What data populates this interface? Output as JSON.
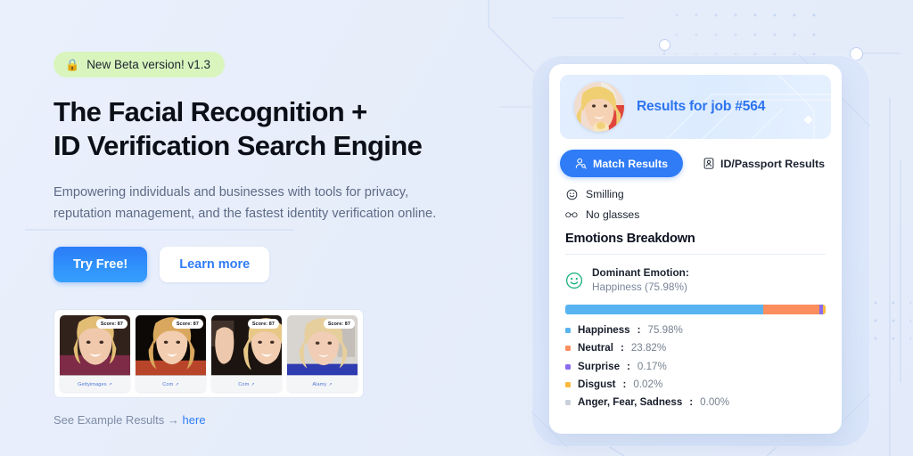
{
  "theme": {
    "page_bg": "#e8eefb",
    "accent_blue": "#2f7cf6",
    "badge_green": "#d9f5bd",
    "text_dark": "#0b0f17",
    "text_muted": "#5d6b86"
  },
  "hero": {
    "badge": {
      "icon": "lock-icon",
      "label": "New Beta version! v1.3"
    },
    "headline_line1": "The Facial Recognition +",
    "headline_line2": "ID Verification Search Engine",
    "subhead_line1": "Empowering individuals and businesses with tools for privacy,",
    "subhead_line2": "reputation management, and the fastest identity verification online.",
    "cta_primary": "Try Free!",
    "cta_secondary": "Learn more",
    "example_prefix": "See Example Results →",
    "example_link": "here"
  },
  "thumbnails": [
    {
      "score_label": "Score: 87",
      "source": "Gettyimages",
      "ext_icon": "↗"
    },
    {
      "score_label": "Score: 87",
      "source": "Com",
      "ext_icon": "↗"
    },
    {
      "score_label": "Score: 87",
      "source": "Com",
      "ext_icon": "↗"
    },
    {
      "score_label": "Score: 87",
      "source": "Alamy",
      "ext_icon": "↗"
    }
  ],
  "result_card": {
    "hero_title": "Results for job #564",
    "avatar_name": "avatar",
    "tabs": [
      {
        "label": "Match Results",
        "icon": "person-search-icon",
        "active": true
      },
      {
        "label": "ID/Passport Results",
        "icon": "id-card-icon",
        "active": false
      }
    ],
    "attributes": [
      {
        "icon": "smiley-icon",
        "label": "Smilling"
      },
      {
        "icon": "glasses-icon",
        "label": "No glasses"
      }
    ],
    "section_title": "Emotions Breakdown",
    "dominant": {
      "icon": "smiley-outline-icon",
      "title": "Dominant Emotion:",
      "value": "Happiness (75.98%)"
    }
  },
  "chart_data": {
    "type": "bar",
    "title": "Emotions Breakdown",
    "subtitle": "Dominant Emotion: Happiness (75.98%)",
    "orientation": "horizontal-stacked",
    "unit": "%",
    "categories": [
      "Happiness",
      "Neutral",
      "Surprise",
      "Disgust",
      "Anger, Fear, Sadness"
    ],
    "values": [
      75.98,
      23.82,
      0.17,
      0.02,
      0.0
    ],
    "colors": [
      "#58b4f0",
      "#fc8e5e",
      "#8a6bee",
      "#fcb83c",
      "#c9d0da"
    ],
    "legend": [
      {
        "label": "Happiness",
        "value": "75.98%",
        "color": "#58b4f0"
      },
      {
        "label": "Neutral",
        "value": "23.82%",
        "color": "#fc8e5e"
      },
      {
        "label": "Surprise",
        "value": "0.17%",
        "color": "#8a6bee"
      },
      {
        "label": "Disgust",
        "value": "0.02%",
        "color": "#fcb83c"
      },
      {
        "label": "Anger, Fear, Sadness",
        "value": "0.00%",
        "color": "#c9d0da"
      }
    ],
    "legend_position": "below",
    "grid": false,
    "xlabel": "",
    "ylabel": "",
    "xlim": [
      0,
      100
    ]
  }
}
